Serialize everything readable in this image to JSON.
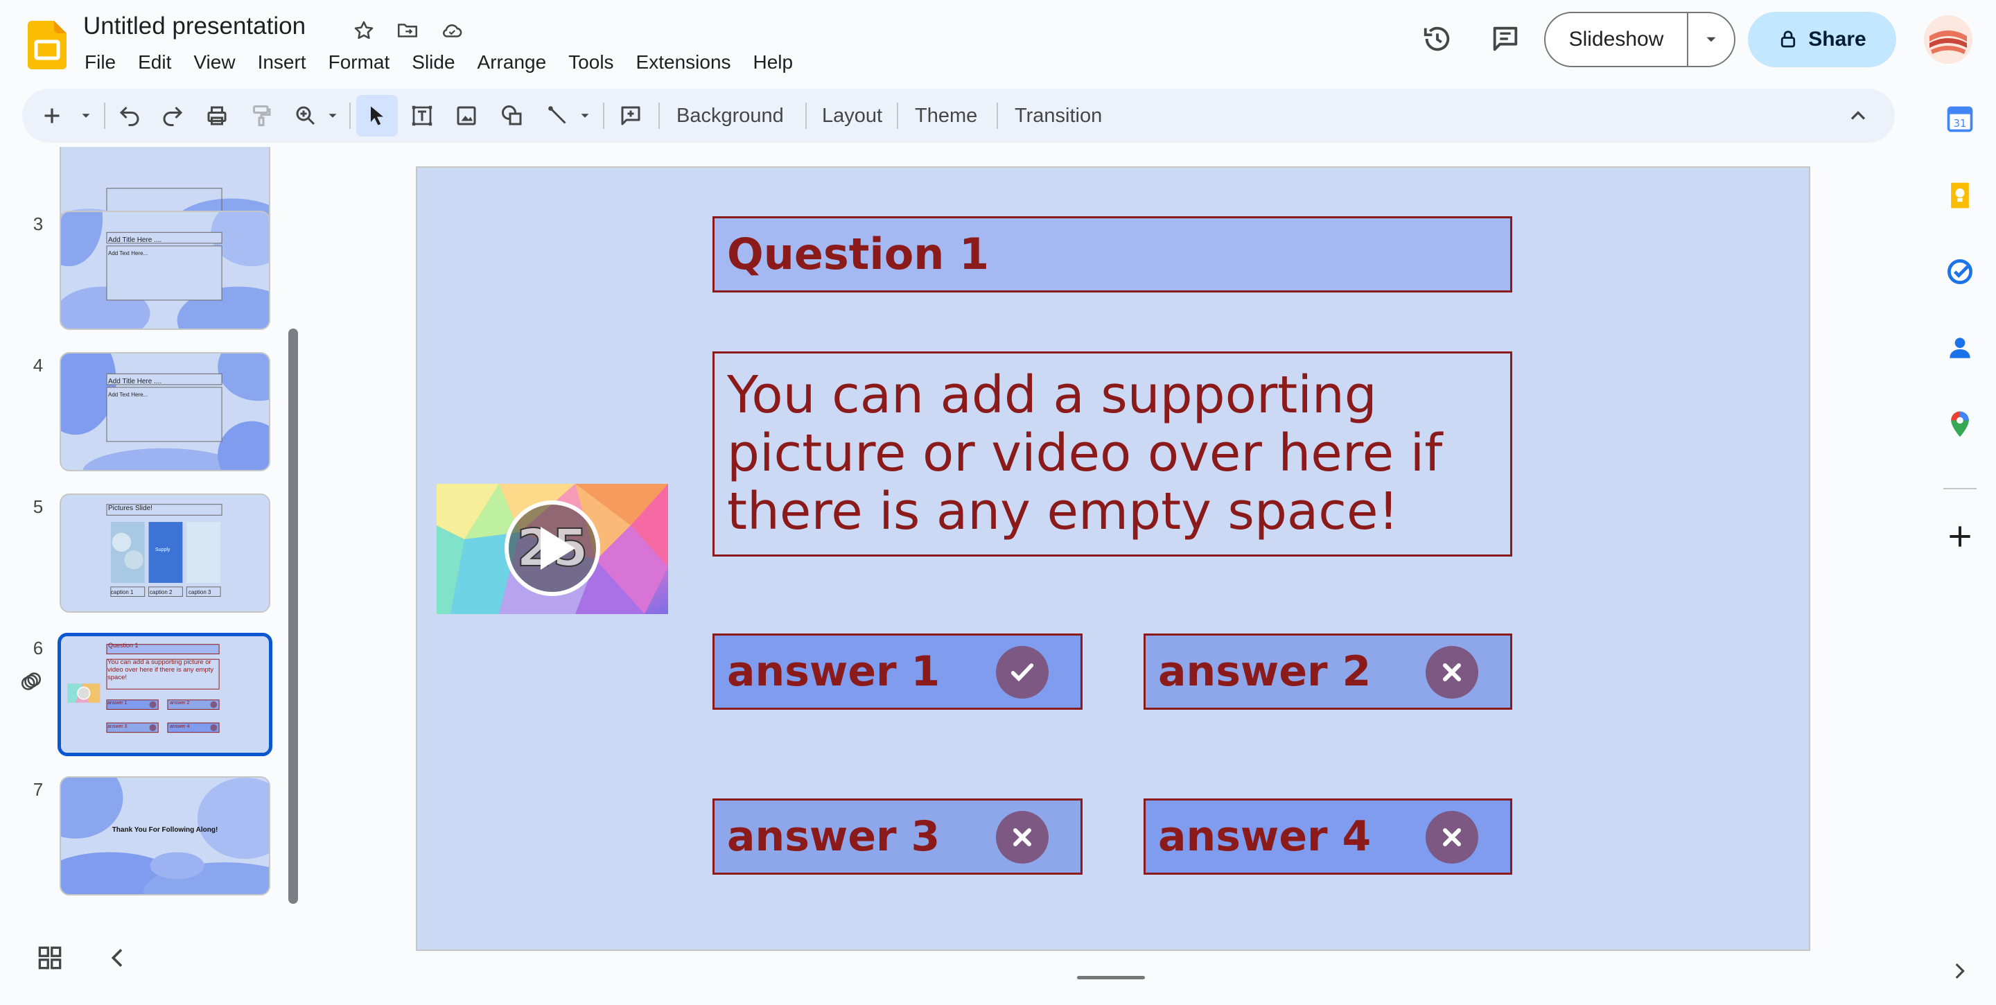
{
  "app": {
    "title": "Untitled presentation",
    "menu": [
      "File",
      "Edit",
      "View",
      "Insert",
      "Format",
      "Slide",
      "Arrange",
      "Tools",
      "Extensions",
      "Help"
    ],
    "slideshow_label": "Slideshow",
    "share_label": "Share"
  },
  "toolbar": {
    "background_label": "Background",
    "layout_label": "Layout",
    "theme_label": "Theme",
    "transition_label": "Transition"
  },
  "filmstrip": {
    "slides": [
      {
        "number": "3",
        "title": "Add Title Here ....",
        "text": "Add Text Here..."
      },
      {
        "number": "4",
        "title": "Add Title Here ....",
        "text": "Add Text Here..."
      },
      {
        "number": "5",
        "title": "Pictures Slide!",
        "img2_text": "Supply",
        "captions": [
          "caption 1",
          "caption 2",
          "caption 3"
        ]
      },
      {
        "number": "6",
        "title": "Question 1",
        "text": "You can add a supporting picture or video over here if there is any empty space!",
        "answers": [
          "answer 1",
          "answer 2",
          "answer 3",
          "answer 4"
        ]
      },
      {
        "number": "7",
        "title": "Thank You For Following Along!"
      }
    ],
    "selected": "6"
  },
  "slide": {
    "question_title": "Question 1",
    "supporting_text": "You can add a supporting picture or video over here if there is any empty space!",
    "answers": [
      {
        "label": "answer 1",
        "mark": "check"
      },
      {
        "label": "answer 2",
        "mark": "cross"
      },
      {
        "label": "answer 3",
        "mark": "cross"
      },
      {
        "label": "answer 4",
        "mark": "cross"
      }
    ],
    "video_badge": "25"
  },
  "colors": {
    "slide_bg": "#ccd9f5",
    "text_dark_red": "#8b1a1a",
    "answer_bg": "#7f9cee",
    "mark_bg": "#7d5883",
    "share_bg": "#c2e7ff",
    "accent": "#0b57d0"
  },
  "side_panel_icons": [
    "calendar-icon",
    "keep-icon",
    "tasks-icon",
    "contacts-icon",
    "maps-icon",
    "add-icon"
  ]
}
